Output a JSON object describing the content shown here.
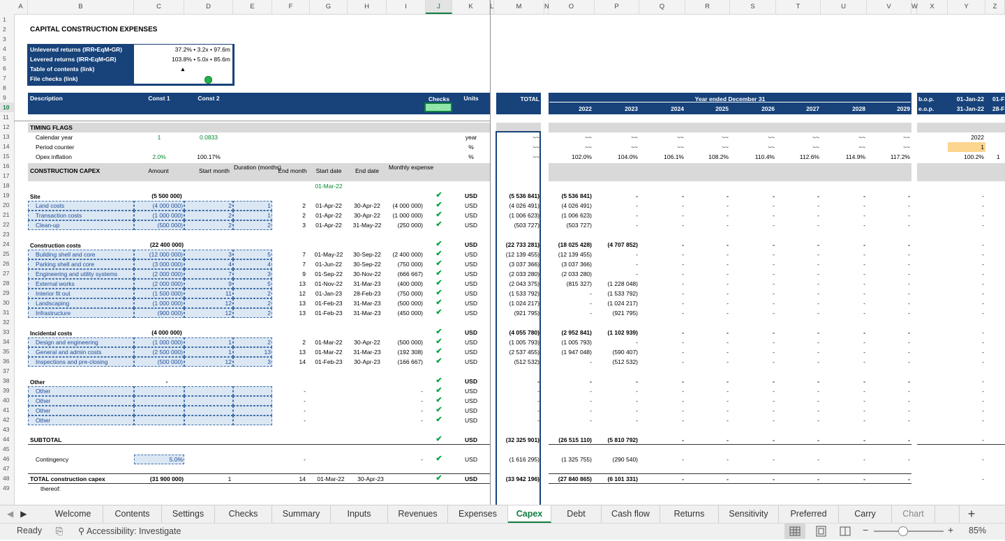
{
  "columns": [
    "A",
    "B",
    "C",
    "D",
    "E",
    "F",
    "G",
    "H",
    "I",
    "J",
    "K",
    "L",
    "M",
    "N",
    "O",
    "P",
    "Q",
    "R",
    "S",
    "T",
    "U",
    "V",
    "W",
    "X",
    "Y",
    "Z"
  ],
  "rows": [
    "1",
    "2",
    "3",
    "4",
    "5",
    "6",
    "7",
    "8",
    "9",
    "10",
    "11",
    "12",
    "13",
    "14",
    "15",
    "16",
    "17",
    "18",
    "19",
    "20",
    "21",
    "22",
    "23",
    "24",
    "25",
    "26",
    "27",
    "28",
    "29",
    "30",
    "31",
    "32",
    "33",
    "34",
    "35",
    "36",
    "37",
    "38",
    "39",
    "40",
    "41",
    "42",
    "43",
    "44",
    "45",
    "46",
    "47",
    "48",
    "49"
  ],
  "selected_cell": {
    "column": "J",
    "row": "10"
  },
  "title": "CAPITAL CONSTRUCTION EXPENSES",
  "summary_box": [
    {
      "label": "Unlevered returns (IRR•EqM•GR)",
      "value": "37.2% • 3.2x • 97.6m"
    },
    {
      "label": "Levered returns (IRR•EqM•GR)",
      "value": "103.8% • 5.0x • 85.6m"
    },
    {
      "label": "Table of contents (link)",
      "value": "▲"
    },
    {
      "label": "File checks (link)",
      "value": ""
    }
  ],
  "header": {
    "description": "Description",
    "const1": "Const 1",
    "const2": "Const 2",
    "checks": "Checks",
    "checks_value": "-",
    "units": "Units",
    "total": "TOTAL",
    "year_ended": "Year ended December 31",
    "years": [
      "2022",
      "2023",
      "2024",
      "2025",
      "2026",
      "2027",
      "2028",
      "2029"
    ],
    "bop": "b.o.p.",
    "eop": "e.o.p.",
    "bop_dates": [
      "01-Jan-22",
      "01-F"
    ],
    "eop_dates": [
      "31-Jan-22",
      "28-F"
    ]
  },
  "timing": {
    "title": "TIMING FLAGS",
    "rows": [
      {
        "label": "Calendar year",
        "c1": "1",
        "c2": "0.0833",
        "unit": "year",
        "total": "~~",
        "years": [
          "~~",
          "~~",
          "~~",
          "~~",
          "~~",
          "~~",
          "~~",
          "~~"
        ],
        "y": "2022",
        "z": ""
      },
      {
        "label": "Period counter",
        "c1": "",
        "c2": "",
        "unit": "%",
        "total": "~~",
        "years": [
          "~~",
          "~~",
          "~~",
          "~~",
          "~~",
          "~~",
          "~~",
          "~~"
        ],
        "y": "1",
        "z": ""
      },
      {
        "label": "Opex inflation",
        "c1": "2.0%",
        "c2": "100.17%",
        "unit": "%",
        "total": "~~",
        "years": [
          "102.0%",
          "104.0%",
          "106.1%",
          "108.2%",
          "110.4%",
          "112.6%",
          "114.9%",
          "117.2%"
        ],
        "y": "100.2%",
        "z": "1"
      }
    ]
  },
  "capex_header": {
    "title": "CONSTRUCTION CAPEX",
    "amount": "Amount",
    "start_month": "Start month",
    "duration": "Duration (months)",
    "end_month": "End month",
    "start_date": "Start date",
    "end_date": "End date",
    "monthly": "Monthly expense",
    "start_ref": "01-Mar-22"
  },
  "groups": [
    {
      "title": "Site",
      "amount": "(5 500 000)",
      "unit": "USD",
      "total": "(5 536 841)",
      "years": [
        "(5 536 841)",
        "-",
        "-",
        "-",
        "-",
        "-",
        "-",
        "-"
      ],
      "y": "-",
      "items": [
        {
          "label": "Land costs",
          "amount": "(4 000 000)",
          "start": "2",
          "dur": "1",
          "end": "2",
          "sdate": "01-Apr-22",
          "edate": "30-Apr-22",
          "monthly": "(4 000 000)",
          "unit": "USD",
          "total": "(4 026 491)",
          "years": [
            "(4 026 491)",
            "-",
            "-",
            "-",
            "-",
            "-",
            "-",
            "-"
          ],
          "y": "-"
        },
        {
          "label": "Transaction costs",
          "amount": "(1 000 000)",
          "start": "2",
          "dur": "1",
          "end": "2",
          "sdate": "01-Apr-22",
          "edate": "30-Apr-22",
          "monthly": "(1 000 000)",
          "unit": "USD",
          "total": "(1 006 623)",
          "years": [
            "(1 006 623)",
            "-",
            "-",
            "-",
            "-",
            "-",
            "-",
            "-"
          ],
          "y": "-"
        },
        {
          "label": "Clean-up",
          "amount": "(500 000)",
          "start": "2",
          "dur": "2",
          "end": "3",
          "sdate": "01-Apr-22",
          "edate": "31-May-22",
          "monthly": "(250 000)",
          "unit": "USD",
          "total": "(503 727)",
          "years": [
            "(503 727)",
            "-",
            "-",
            "-",
            "-",
            "-",
            "-",
            "-"
          ],
          "y": "-"
        }
      ]
    },
    {
      "title": "Construction costs",
      "amount": "(22 400 000)",
      "unit": "USD",
      "total": "(22 733 281)",
      "years": [
        "(18 025 428)",
        "(4 707 852)",
        "-",
        "-",
        "-",
        "-",
        "-",
        "-"
      ],
      "y": "-",
      "items": [
        {
          "label": "Building shell and core",
          "amount": "(12 000 000)",
          "start": "3",
          "dur": "5",
          "end": "7",
          "sdate": "01-May-22",
          "edate": "30-Sep-22",
          "monthly": "(2 400 000)",
          "unit": "USD",
          "total": "(12 139 455)",
          "years": [
            "(12 139 455)",
            "-",
            "-",
            "-",
            "-",
            "-",
            "-",
            "-"
          ],
          "y": "-"
        },
        {
          "label": "Parking shell and core",
          "amount": "(3 000 000)",
          "start": "4",
          "dur": "4",
          "end": "7",
          "sdate": "01-Jun-22",
          "edate": "30-Sep-22",
          "monthly": "(750 000)",
          "unit": "USD",
          "total": "(3 037 366)",
          "years": [
            "(3 037 366)",
            "-",
            "-",
            "-",
            "-",
            "-",
            "-",
            "-"
          ],
          "y": "-"
        },
        {
          "label": "Engineering and utility systems",
          "amount": "(2 000 000)",
          "start": "7",
          "dur": "3",
          "end": "9",
          "sdate": "01-Sep-22",
          "edate": "30-Nov-22",
          "monthly": "(666 667)",
          "unit": "USD",
          "total": "(2 033 280)",
          "years": [
            "(2 033 280)",
            "-",
            "-",
            "-",
            "-",
            "-",
            "-",
            "-"
          ],
          "y": "-"
        },
        {
          "label": "External works",
          "amount": "(2 000 000)",
          "start": "9",
          "dur": "5",
          "end": "13",
          "sdate": "01-Nov-22",
          "edate": "31-Mar-23",
          "monthly": "(400 000)",
          "unit": "USD",
          "total": "(2 043 375)",
          "years": [
            "(815 327)",
            "(1 228 048)",
            "-",
            "-",
            "-",
            "-",
            "-",
            "-"
          ],
          "y": "-"
        },
        {
          "label": "Interior fit out",
          "amount": "(1 500 000)",
          "start": "11",
          "dur": "2",
          "end": "12",
          "sdate": "01-Jan-23",
          "edate": "28-Feb-23",
          "monthly": "(750 000)",
          "unit": "USD",
          "total": "(1 533 792)",
          "years": [
            "-",
            "(1 533 792)",
            "-",
            "-",
            "-",
            "-",
            "-",
            "-"
          ],
          "y": "-"
        },
        {
          "label": "Landscaping",
          "amount": "(1 000 000)",
          "start": "12",
          "dur": "2",
          "end": "13",
          "sdate": "01-Feb-23",
          "edate": "31-Mar-23",
          "monthly": "(500 000)",
          "unit": "USD",
          "total": "(1 024 217)",
          "years": [
            "-",
            "(1 024 217)",
            "-",
            "-",
            "-",
            "-",
            "-",
            "-"
          ],
          "y": "-"
        },
        {
          "label": "Infrastructure",
          "amount": "(900 000)",
          "start": "12",
          "dur": "2",
          "end": "13",
          "sdate": "01-Feb-23",
          "edate": "31-Mar-23",
          "monthly": "(450 000)",
          "unit": "USD",
          "total": "(921 795)",
          "years": [
            "-",
            "(921 795)",
            "-",
            "-",
            "-",
            "-",
            "-",
            "-"
          ],
          "y": "-"
        }
      ]
    },
    {
      "title": "Incidental costs",
      "amount": "(4 000 000)",
      "unit": "USD",
      "total": "(4 055 780)",
      "years": [
        "(2 952 841)",
        "(1 102 939)",
        "-",
        "-",
        "-",
        "-",
        "-",
        "-"
      ],
      "y": "-",
      "items": [
        {
          "label": "Design and engineering",
          "amount": "(1 000 000)",
          "start": "1",
          "dur": "2",
          "end": "2",
          "sdate": "01-Mar-22",
          "edate": "30-Apr-22",
          "monthly": "(500 000)",
          "unit": "USD",
          "total": "(1 005 793)",
          "years": [
            "(1 005 793)",
            "-",
            "-",
            "-",
            "-",
            "-",
            "-",
            "-"
          ],
          "y": "-"
        },
        {
          "label": "General and admin costs",
          "amount": "(2 500 000)",
          "start": "1",
          "dur": "13",
          "end": "13",
          "sdate": "01-Mar-22",
          "edate": "31-Mar-23",
          "monthly": "(192 308)",
          "unit": "USD",
          "total": "(2 537 455)",
          "years": [
            "(1 947 048)",
            "(590 407)",
            "-",
            "-",
            "-",
            "-",
            "-",
            "-"
          ],
          "y": "-"
        },
        {
          "label": "Inspections and pre-closing",
          "amount": "(500 000)",
          "start": "12",
          "dur": "3",
          "end": "14",
          "sdate": "01-Feb-23",
          "edate": "30-Apr-23",
          "monthly": "(166 667)",
          "unit": "USD",
          "total": "(512 532)",
          "years": [
            "-",
            "(512 532)",
            "-",
            "-",
            "-",
            "-",
            "-",
            "-"
          ],
          "y": "-"
        }
      ]
    },
    {
      "title": "Other",
      "amount": "-",
      "unit": "USD",
      "total": "-",
      "years": [
        "-",
        "-",
        "-",
        "-",
        "-",
        "-",
        "-",
        "-"
      ],
      "y": "-",
      "items": [
        {
          "label": "Other",
          "amount": "",
          "start": "",
          "dur": "",
          "end": "-",
          "sdate": "",
          "edate": "",
          "monthly": "-",
          "unit": "USD",
          "total": "-",
          "years": [
            "-",
            "-",
            "-",
            "-",
            "-",
            "-",
            "-",
            "-"
          ],
          "y": "-"
        },
        {
          "label": "Other",
          "amount": "",
          "start": "",
          "dur": "",
          "end": "-",
          "sdate": "",
          "edate": "",
          "monthly": "-",
          "unit": "USD",
          "total": "-",
          "years": [
            "-",
            "-",
            "-",
            "-",
            "-",
            "-",
            "-",
            "-"
          ],
          "y": "-"
        },
        {
          "label": "Other",
          "amount": "",
          "start": "",
          "dur": "",
          "end": "-",
          "sdate": "",
          "edate": "",
          "monthly": "-",
          "unit": "USD",
          "total": "-",
          "years": [
            "-",
            "-",
            "-",
            "-",
            "-",
            "-",
            "-",
            "-"
          ],
          "y": "-"
        },
        {
          "label": "Other",
          "amount": "",
          "start": "",
          "dur": "",
          "end": "-",
          "sdate": "",
          "edate": "",
          "monthly": "-",
          "unit": "USD",
          "total": "-",
          "years": [
            "-",
            "-",
            "-",
            "-",
            "-",
            "-",
            "-",
            "-"
          ],
          "y": "-"
        }
      ]
    }
  ],
  "subtotal": {
    "label": "SUBTOTAL",
    "unit": "USD",
    "total": "(32 325 901)",
    "years": [
      "(26 515 110)",
      "(5 810 792)",
      "-",
      "-",
      "-",
      "-",
      "-",
      "-"
    ],
    "y": "-"
  },
  "contingency": {
    "label": "Contingency",
    "value": "5.0%",
    "end": "-",
    "monthly": "-",
    "unit": "USD",
    "total": "(1 616 295)",
    "years": [
      "(1 325 755)",
      "(290 540)",
      "-",
      "-",
      "-",
      "-",
      "-",
      "-"
    ],
    "y": "-"
  },
  "total_capex": {
    "label": "TOTAL construction capex",
    "amount": "(31 900 000)",
    "start": "1",
    "end": "14",
    "sdate": "01-Mar-22",
    "edate": "30-Apr-23",
    "unit": "USD",
    "total": "(33 942 196)",
    "years": [
      "(27 840 865)",
      "(6 101 331)",
      "-",
      "-",
      "-",
      "-",
      "-",
      "-"
    ],
    "y": "-"
  },
  "thereof": "thereof:",
  "tabs": [
    "Welcome",
    "Contents",
    "Settings",
    "Checks",
    "Summary",
    "Inputs",
    "Revenues",
    "Expenses",
    "Capex",
    "Debt",
    "Cash flow",
    "Returns",
    "Sensitivity",
    "Preferred",
    "Carry",
    "Chart"
  ],
  "active_tab": "Capex",
  "status": {
    "ready": "Ready",
    "accessibility": "Accessibility: Investigate",
    "zoom": "85%"
  },
  "colors": {
    "header_blue": "#17427a",
    "excel_green": "#107c41",
    "input_fill": "#dbe7f3",
    "check_green": "#00a33b"
  }
}
